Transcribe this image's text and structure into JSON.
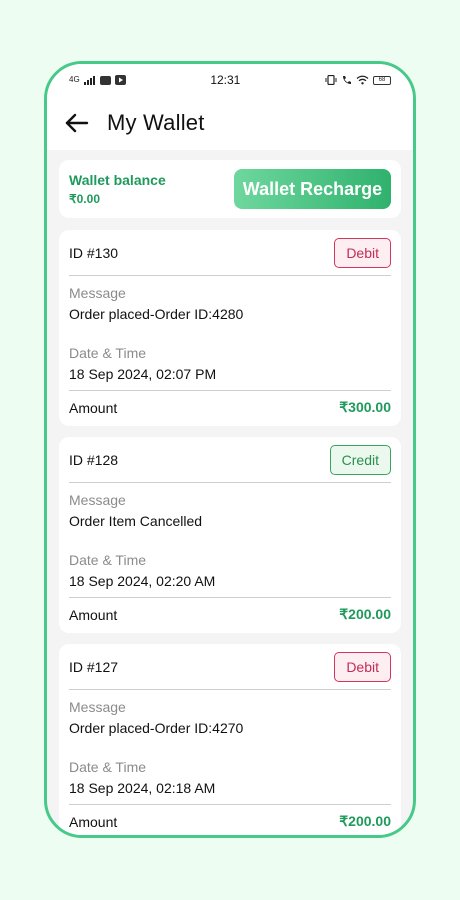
{
  "status_bar": {
    "network": "4G",
    "time": "12:31",
    "battery": "68"
  },
  "header": {
    "title": "My Wallet"
  },
  "wallet": {
    "balance_label": "Wallet balance",
    "balance_value": "₹0.00",
    "recharge_label": "Wallet Recharge"
  },
  "transactions": [
    {
      "id": "ID #130",
      "type": "Debit",
      "message_label": "Message",
      "message": "Order placed-Order ID:4280",
      "datetime_label": "Date & Time",
      "datetime": "18 Sep 2024, 02:07 PM",
      "amount_label": "Amount",
      "amount": "₹300.00"
    },
    {
      "id": "ID #128",
      "type": "Credit",
      "message_label": "Message",
      "message": "Order Item Cancelled",
      "datetime_label": "Date & Time",
      "datetime": "18 Sep 2024, 02:20 AM",
      "amount_label": "Amount",
      "amount": "₹200.00"
    },
    {
      "id": "ID #127",
      "type": "Debit",
      "message_label": "Message",
      "message": "Order placed-Order ID:4270",
      "datetime_label": "Date & Time",
      "datetime": "18 Sep 2024, 02:18 AM",
      "amount_label": "Amount",
      "amount": "₹200.00"
    }
  ],
  "colors": {
    "accent": "#1f9a5c",
    "frame": "#47c98a",
    "debit": "#c42c56",
    "credit": "#2b8f4d"
  }
}
